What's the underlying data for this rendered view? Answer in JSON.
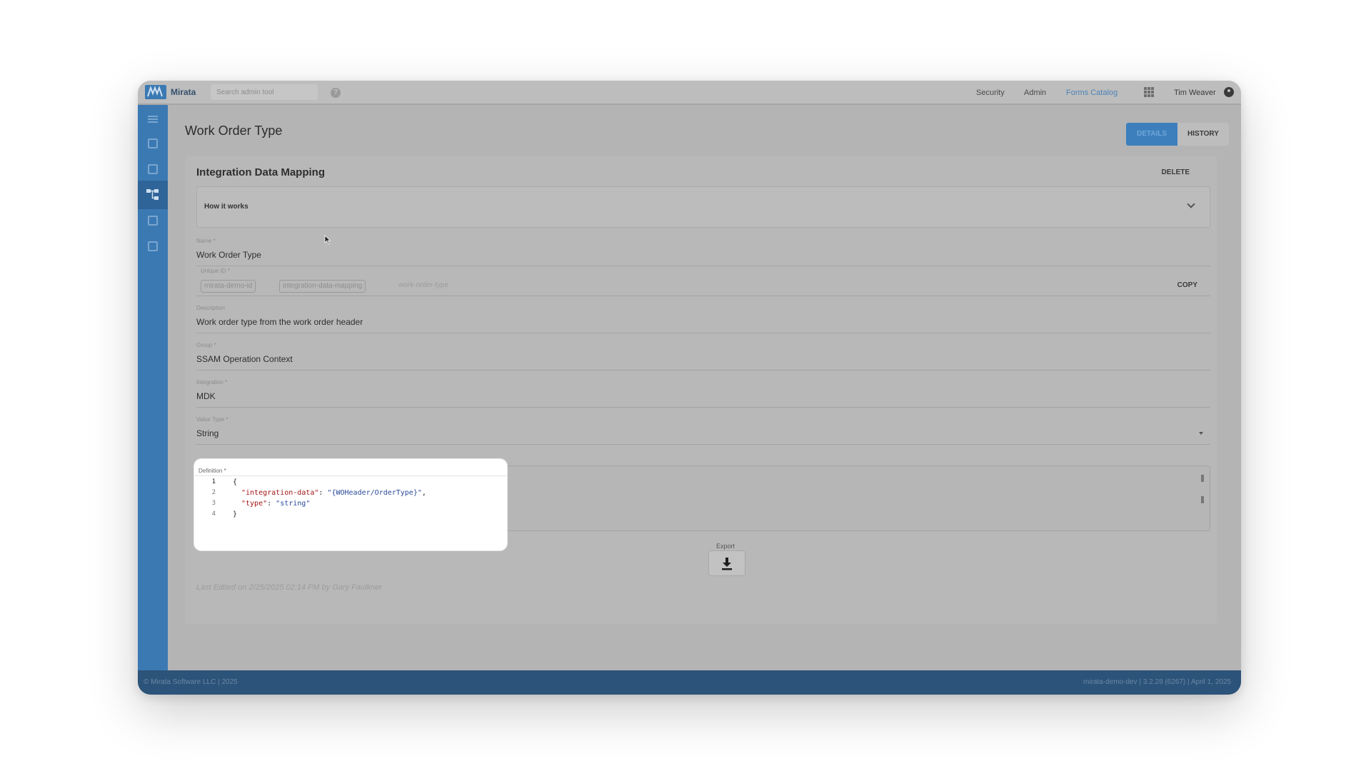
{
  "app": {
    "logo_text": "Mirata"
  },
  "topbar": {
    "search_placeholder": "Search admin tool",
    "help_icon": "?",
    "nav": {
      "security": "Security",
      "admin": "Admin",
      "forms_catalog": "Forms Catalog"
    },
    "user_name": "Tim Weaver"
  },
  "page": {
    "title": "Work Order Type",
    "tabs": {
      "details": "DETAILS",
      "history": "HISTORY"
    }
  },
  "card": {
    "title": "Integration Data Mapping",
    "delete_label": "DELETE",
    "how_it_works": "How it works",
    "fields": {
      "name": {
        "label": "Name *",
        "value": "Work Order Type"
      },
      "unique_id": {
        "label": "Unique ID *",
        "chips": [
          "mirata-demo-id",
          "integration-data-mapping"
        ],
        "placeholder": "work-order-type",
        "copy_label": "COPY"
      },
      "description": {
        "label": "Description",
        "value": "Work order type from the work order header"
      },
      "group": {
        "label": "Group *",
        "value": "SSAM Operation Context"
      },
      "integration": {
        "label": "Integration *",
        "value": "MDK"
      },
      "value_type": {
        "label": "Value Type *",
        "value": "String"
      }
    },
    "definition": {
      "label": "Definition *",
      "line_numbers": [
        "1",
        "2",
        "3",
        "4"
      ],
      "lines": {
        "l1": "{",
        "l2_key": "\"integration-data\"",
        "l2_sep": ": ",
        "l2_val": "\"{WOHeader/OrderType}\"",
        "l2_end": ",",
        "l3_key": "\"type\"",
        "l3_sep": ": ",
        "l3_val": "\"string\"",
        "l4": "}"
      }
    },
    "export_label": "Export",
    "last_edited": "Last Edited on 2/25/2025 02:14 PM by Gary Faulkner"
  },
  "footer": {
    "left": "© Mirata Software LLC | 2025",
    "right": "mirata-demo-dev | 3.2.28 (6267) | April 1, 2025"
  },
  "colors": {
    "sidebar": "#3b79b3",
    "footer": "#2c5379",
    "accent": "#3d7fbd",
    "overlay_gray": "#b4b4b4",
    "highlight_bg": "#ffffff"
  },
  "icons": {
    "sidebar": [
      "menu-icon",
      "list-icon",
      "copy-icon",
      "hierarchy-icon",
      "image-icon",
      "clipboard-icon"
    ],
    "export": "download-icon"
  }
}
